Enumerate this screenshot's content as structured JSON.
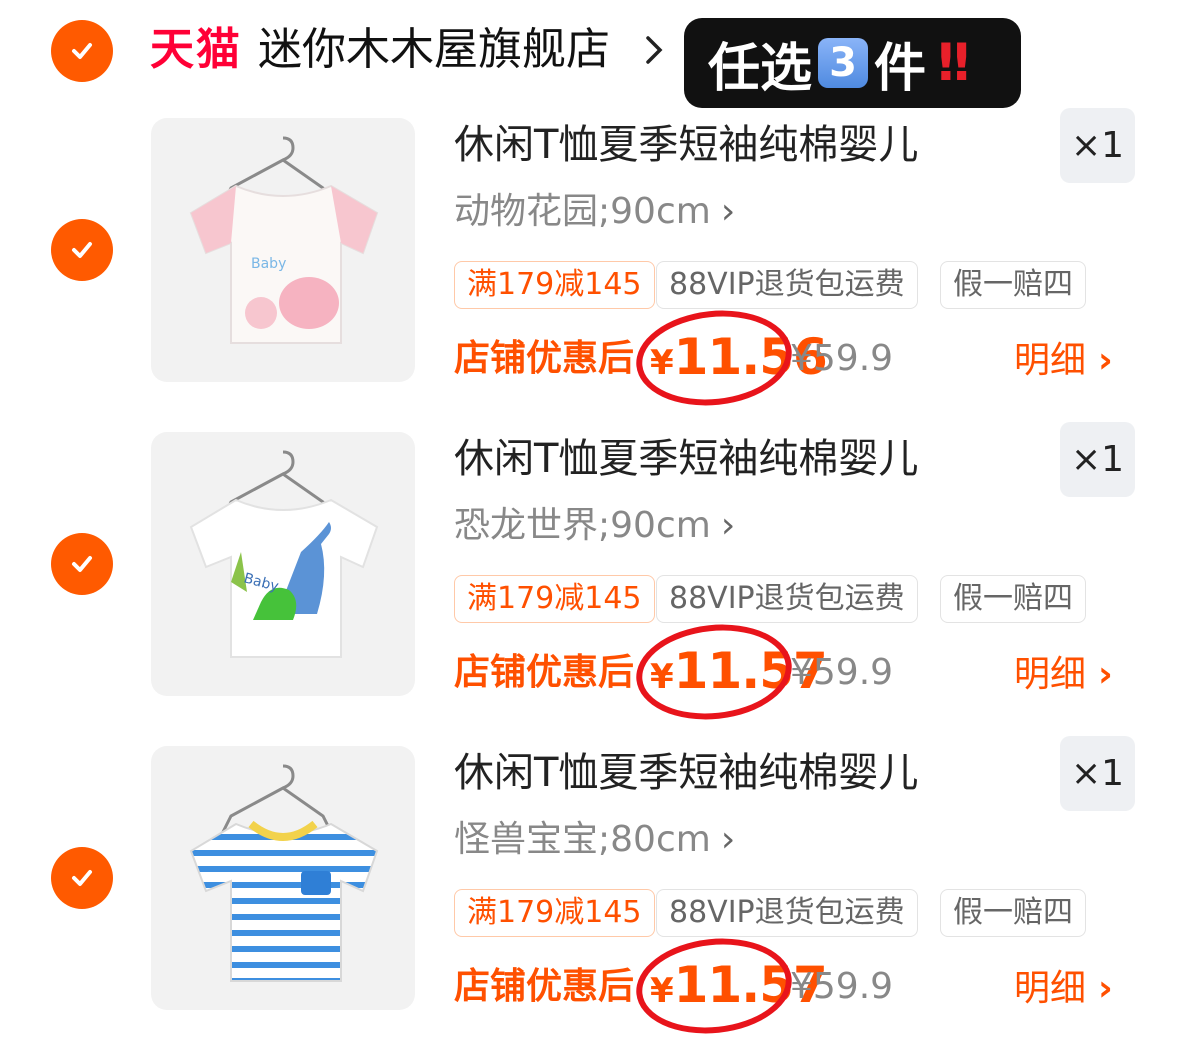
{
  "store": {
    "platform": "天猫",
    "name": "迷你木木屋旗舰店",
    "promo_text_before": "任选",
    "promo_number": "3",
    "promo_text_after": "件",
    "promo_mark": "!!"
  },
  "items": [
    {
      "title": "休闲T恤夏季短袖纯棉婴儿",
      "sku": "动物花园;90cm",
      "quantity": "×1",
      "tags": [
        "满179减145",
        "88VIP退货包运费",
        "假一赔四"
      ],
      "price_label": "店铺优惠后",
      "currency": "¥",
      "price": "11.56",
      "original_price": "¥59.9",
      "detail_label": "明细",
      "thumbnail_icon": "pink-animal-tshirt-icon"
    },
    {
      "title": "休闲T恤夏季短袖纯棉婴儿",
      "sku": "恐龙世界;90cm",
      "quantity": "×1",
      "tags": [
        "满179减145",
        "88VIP退货包运费",
        "假一赔四"
      ],
      "price_label": "店铺优惠后",
      "currency": "¥",
      "price": "11.57",
      "original_price": "¥59.9",
      "detail_label": "明细",
      "thumbnail_icon": "dinosaur-tshirt-icon"
    },
    {
      "title": "休闲T恤夏季短袖纯棉婴儿",
      "sku": "怪兽宝宝;80cm",
      "quantity": "×1",
      "tags": [
        "满179减145",
        "88VIP退货包运费",
        "假一赔四"
      ],
      "price_label": "店铺优惠后",
      "currency": "¥",
      "price": "11.57",
      "original_price": "¥59.9",
      "detail_label": "明细",
      "thumbnail_icon": "striped-tshirt-icon"
    }
  ],
  "colors": {
    "accent": "#ff5000",
    "check": "#ff5a00",
    "tmall": "#ff0036",
    "circle": "#e8141b"
  }
}
